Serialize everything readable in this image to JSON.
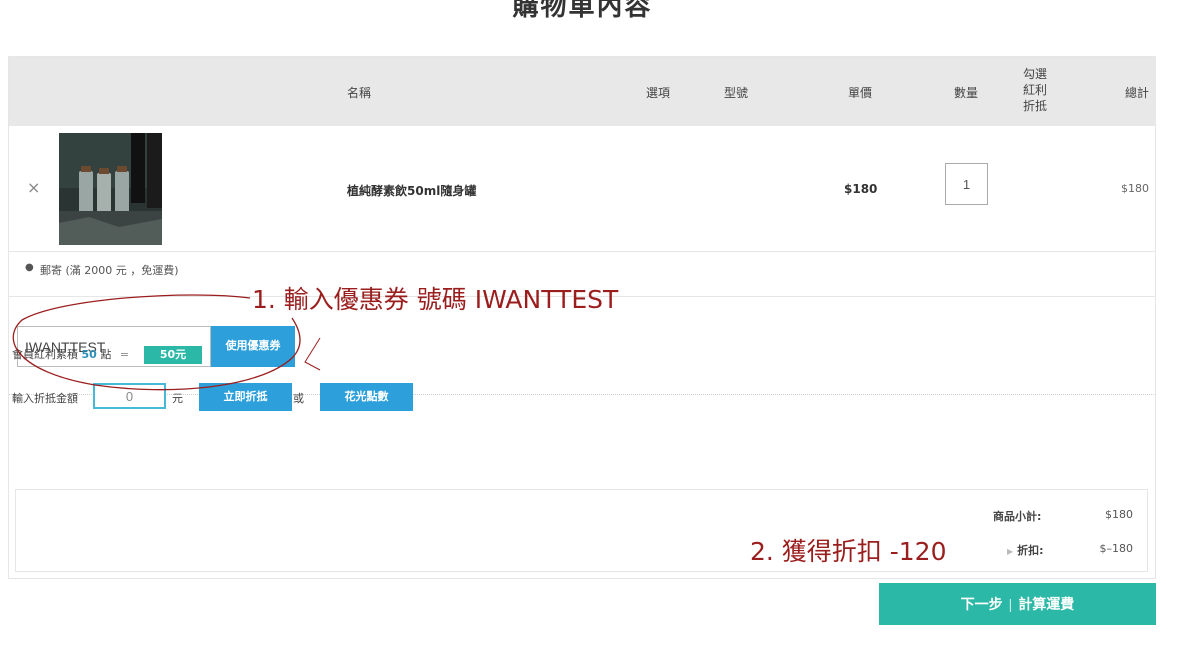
{
  "page": {
    "title": "購物車內容"
  },
  "table": {
    "headers": {
      "name": "名稱",
      "option": "選項",
      "model": "型號",
      "unit_price": "單價",
      "quantity": "數量",
      "bonus_line1": "勾選",
      "bonus_line2": "紅利",
      "bonus_line3": "折抵",
      "total": "總計"
    },
    "rows": [
      {
        "remove_icon": "×",
        "name": "植純酵素飲50ml隨身罐",
        "unit_price": "$180",
        "quantity": "1",
        "total": "$180"
      }
    ]
  },
  "shipping": {
    "bullet": "●",
    "text": "郵寄 (滿 2000 元 ，免運費)"
  },
  "coupon": {
    "value": "IWANTTEST",
    "button": "使用優惠券"
  },
  "points": {
    "prefix": "會員紅利累積",
    "count": "50",
    "unit": "點",
    "equals": "=",
    "badge": "50元"
  },
  "redeem": {
    "label": "輸入折抵金額",
    "value": "0",
    "unit": "元",
    "apply_button": "立即折抵",
    "or": "或",
    "spend_all_button": "花光點數"
  },
  "summary": {
    "subtotal_label": "商品小計:",
    "subtotal_value": "$180",
    "discount_label": "折扣:",
    "discount_value": "$–180"
  },
  "next": {
    "label_part1": "下一步",
    "separator": "|",
    "label_part2": "計算運費"
  },
  "annotations": {
    "step1": "1. 輸入優惠券 號碼 IWANTTEST",
    "step2": "2. 獲得折扣 -120"
  },
  "colors": {
    "accent_teal": "#2bb8a6",
    "button_blue": "#2d9fda",
    "annotation_red": "#9b1e1e"
  }
}
